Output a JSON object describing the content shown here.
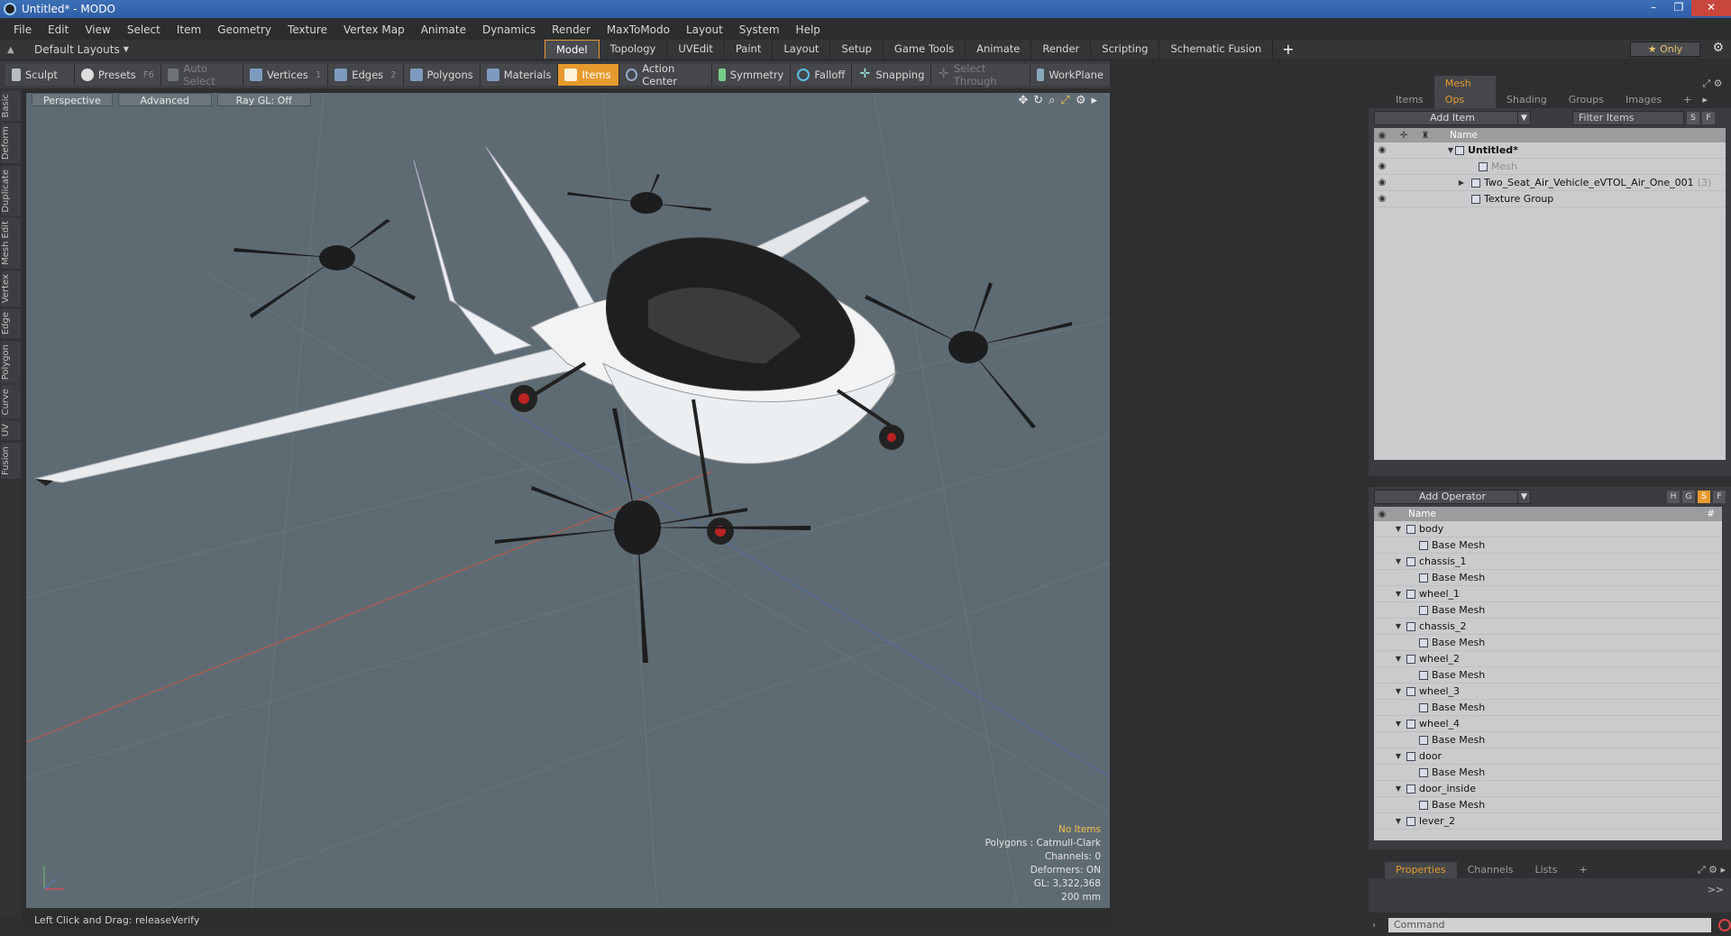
{
  "window": {
    "title": "Untitled* - MODO"
  },
  "menu": [
    "File",
    "Edit",
    "View",
    "Select",
    "Item",
    "Geometry",
    "Texture",
    "Vertex Map",
    "Animate",
    "Dynamics",
    "Render",
    "MaxToModo",
    "Layout",
    "System",
    "Help"
  ],
  "layout": {
    "selector": "Default Layouts",
    "tabs": [
      "Model",
      "Topology",
      "UVEdit",
      "Paint",
      "Layout",
      "Setup",
      "Game Tools",
      "Animate",
      "Render",
      "Scripting",
      "Schematic Fusion"
    ],
    "active_tab": "Model",
    "add_tab": "+",
    "only_label": "Only"
  },
  "toolbar": {
    "sculpt": "Sculpt",
    "presets": "Presets",
    "presets_key": "F6",
    "auto_select": "Auto Select",
    "vertices": "Vertices",
    "vertices_key": "1",
    "edges": "Edges",
    "edges_key": "2",
    "polygons": "Polygons",
    "materials": "Materials",
    "items": "Items",
    "action_center": "Action Center",
    "symmetry": "Symmetry",
    "falloff": "Falloff",
    "snapping": "Snapping",
    "select_through": "Select Through",
    "workplane": "WorkPlane"
  },
  "left_tabs": [
    "Basic",
    "Deform",
    "Duplicate",
    "Mesh Edit",
    "Vertex",
    "Edge",
    "Polygon",
    "Curve",
    "UV",
    "Fusion"
  ],
  "viewport": {
    "view": "Perspective",
    "shading": "Advanced",
    "raygl": "Ray GL: Off",
    "info": {
      "selection": "No Items",
      "polygons": "Polygons : Catmull-Clark",
      "channels": "Channels: 0",
      "deformers": "Deformers: ON",
      "gl": "GL: 3,322,368",
      "scale": "200 mm"
    }
  },
  "status": {
    "text": "Left Click and Drag:   releaseVerify"
  },
  "items_panel": {
    "tabs": [
      "Items",
      "Mesh Ops",
      "Shading",
      "Groups",
      "Images",
      "+"
    ],
    "active": "Mesh Ops",
    "add_item": "Add Item",
    "filter": "Filter Items",
    "s": "S",
    "f": "F",
    "col_name": "Name",
    "tree": [
      {
        "label": "Untitled*",
        "depth": 0,
        "expanded": true,
        "bold": true
      },
      {
        "label": "Mesh",
        "depth": 1,
        "dim": true
      },
      {
        "label": "Two_Seat_Air_Vehicle_eVTOL_Air_One_001",
        "suffix": "(3)",
        "depth": 1,
        "collapsed": true
      },
      {
        "label": "Texture Group",
        "depth": 1
      }
    ]
  },
  "meshops_panel": {
    "add_operator": "Add Operator",
    "h": "H",
    "g": "G",
    "s": "S",
    "f": "F",
    "col_name": "Name",
    "col_hash": "#",
    "rows": [
      {
        "label": "body",
        "child": "Base Mesh"
      },
      {
        "label": "chassis_1",
        "child": "Base Mesh"
      },
      {
        "label": "wheel_1",
        "child": "Base Mesh"
      },
      {
        "label": "chassis_2",
        "child": "Base Mesh"
      },
      {
        "label": "wheel_2",
        "child": "Base Mesh"
      },
      {
        "label": "wheel_3",
        "child": "Base Mesh"
      },
      {
        "label": "wheel_4",
        "child": "Base Mesh"
      },
      {
        "label": "door",
        "child": "Base Mesh"
      },
      {
        "label": "door_inside",
        "child": "Base Mesh"
      },
      {
        "label": "lever_2",
        "child": ""
      }
    ]
  },
  "properties_panel": {
    "tabs": [
      "Properties",
      "Channels",
      "Lists",
      "+"
    ],
    "active": "Properties",
    "expand": ">>"
  },
  "command": {
    "placeholder": "Command"
  },
  "colors": {
    "accent": "#e69a2e",
    "viewport": "#5f6b72"
  }
}
